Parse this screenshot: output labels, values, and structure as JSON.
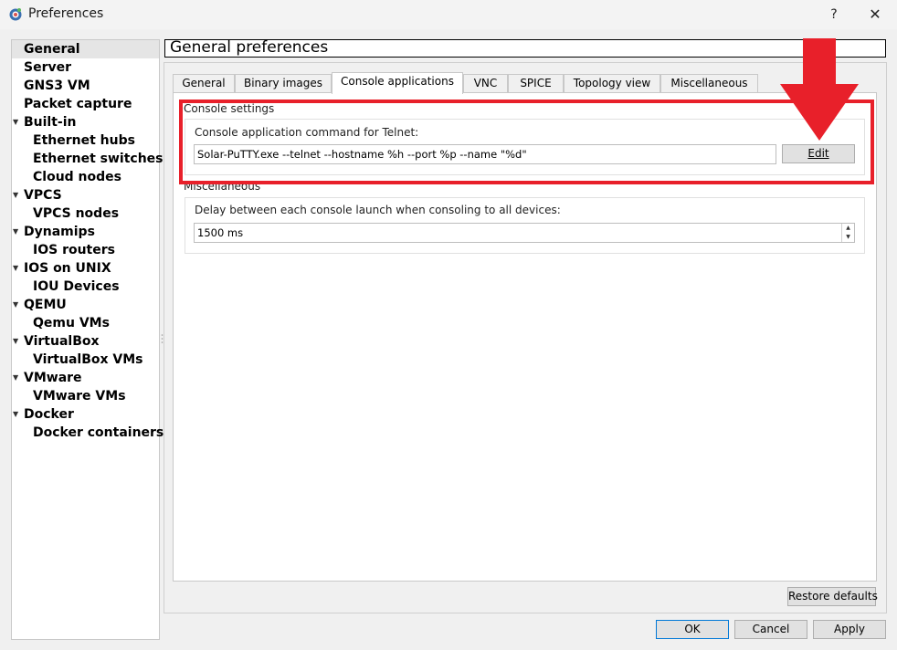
{
  "window": {
    "title": "Preferences",
    "help_label": "?",
    "close_label": "✕",
    "icon": "gns3-app-icon"
  },
  "sidebar": {
    "items": [
      {
        "label": "General",
        "level": 0,
        "expandable": false,
        "selected": true
      },
      {
        "label": "Server",
        "level": 0,
        "expandable": false
      },
      {
        "label": "GNS3 VM",
        "level": 0,
        "expandable": false
      },
      {
        "label": "Packet capture",
        "level": 0,
        "expandable": false
      },
      {
        "label": "Built-in",
        "level": 0,
        "expandable": true
      },
      {
        "label": "Ethernet hubs",
        "level": 1
      },
      {
        "label": "Ethernet switches",
        "level": 1
      },
      {
        "label": "Cloud nodes",
        "level": 1
      },
      {
        "label": "VPCS",
        "level": 0,
        "expandable": true
      },
      {
        "label": "VPCS nodes",
        "level": 1
      },
      {
        "label": "Dynamips",
        "level": 0,
        "expandable": true
      },
      {
        "label": "IOS routers",
        "level": 1
      },
      {
        "label": "IOS on UNIX",
        "level": 0,
        "expandable": true
      },
      {
        "label": "IOU Devices",
        "level": 1
      },
      {
        "label": "QEMU",
        "level": 0,
        "expandable": true
      },
      {
        "label": "Qemu VMs",
        "level": 1
      },
      {
        "label": "VirtualBox",
        "level": 0,
        "expandable": true
      },
      {
        "label": "VirtualBox VMs",
        "level": 1
      },
      {
        "label": "VMware",
        "level": 0,
        "expandable": true
      },
      {
        "label": "VMware VMs",
        "level": 1
      },
      {
        "label": "Docker",
        "level": 0,
        "expandable": true
      },
      {
        "label": "Docker containers",
        "level": 1
      }
    ]
  },
  "header": {
    "title": "General preferences"
  },
  "tabs": [
    {
      "label": "General"
    },
    {
      "label": "Binary images"
    },
    {
      "label": "Console applications",
      "active": true
    },
    {
      "label": "VNC"
    },
    {
      "label": "SPICE"
    },
    {
      "label": "Topology view"
    },
    {
      "label": "Miscellaneous"
    }
  ],
  "console_settings": {
    "group_label": "Console settings",
    "telnet_label": "Console application command for Telnet:",
    "telnet_command": "Solar-PuTTY.exe --telnet --hostname %h --port %p  --name \"%d\"",
    "edit_label": "Edit"
  },
  "misc": {
    "group_label": "Miscellaneous",
    "delay_label": "Delay between each console launch when consoling to all devices:",
    "delay_value": "1500 ms"
  },
  "buttons": {
    "restore_defaults": "Restore defaults",
    "ok": "OK",
    "cancel": "Cancel",
    "apply": "Apply"
  },
  "colors": {
    "annotation_red": "#e8202a",
    "selection_bg": "#e5e5e5",
    "primary_border": "#0078d7"
  }
}
